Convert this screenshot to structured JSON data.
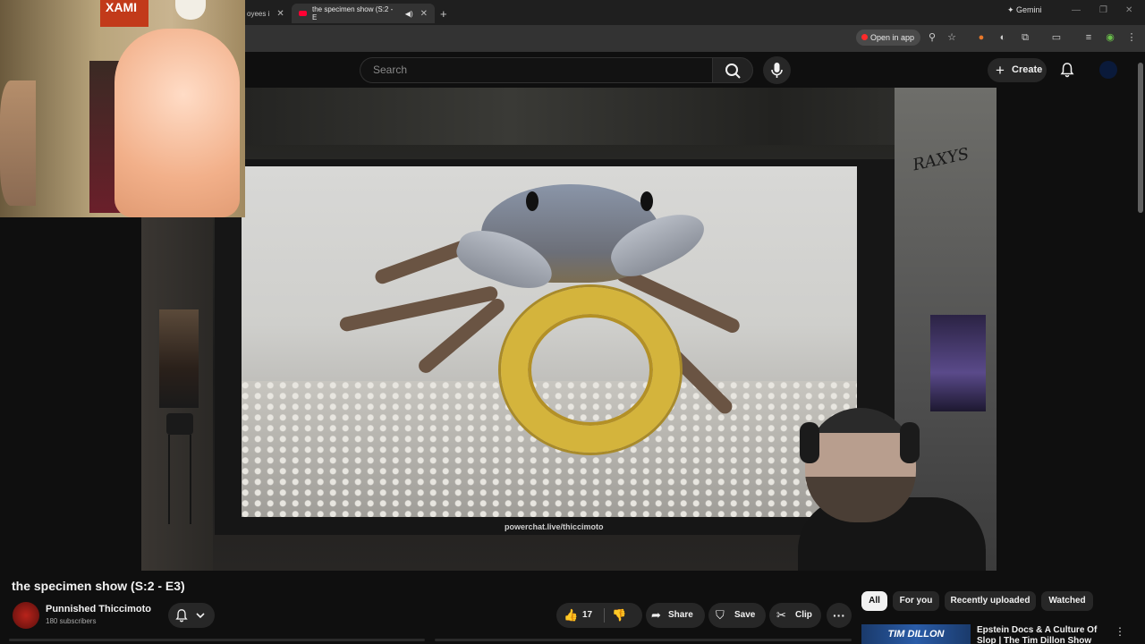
{
  "browser": {
    "tabs": [
      {
        "label": "oyees i",
        "active": false
      },
      {
        "label": "the specimen show (S:2 - E",
        "active": true
      }
    ],
    "new_tab": "+",
    "gemini_label": "Gemini",
    "open_in_app_label": "Open in app"
  },
  "header": {
    "search_placeholder": "Search",
    "create_label": "Create"
  },
  "video": {
    "watermark": "powerchat.live/thiccimoto",
    "webcam_poster_text": "XAMI",
    "graffiti_text": "RAXYS"
  },
  "details": {
    "title": "the specimen show (S:2 - E3)",
    "channel_name": "Punnished Thiccimoto",
    "subscribers": "180 subscribers",
    "like_count": "17",
    "share_label": "Share",
    "save_label": "Save",
    "clip_label": "Clip",
    "more_label": "···"
  },
  "filter_chips": [
    {
      "label": "All",
      "active": true
    },
    {
      "label": "For you",
      "active": false
    },
    {
      "label": "Recently uploaded",
      "active": false
    },
    {
      "label": "Watched",
      "active": false
    }
  ],
  "recommendation": {
    "thumb_text": "TIM DILLON",
    "title": "Epstein Docs & A Culture Of Slop | The Tim Dillon Show"
  },
  "colors": {
    "background": "#0f0f0f",
    "accent_red": "#ff0000",
    "chip_active": "#f1f1f1"
  }
}
